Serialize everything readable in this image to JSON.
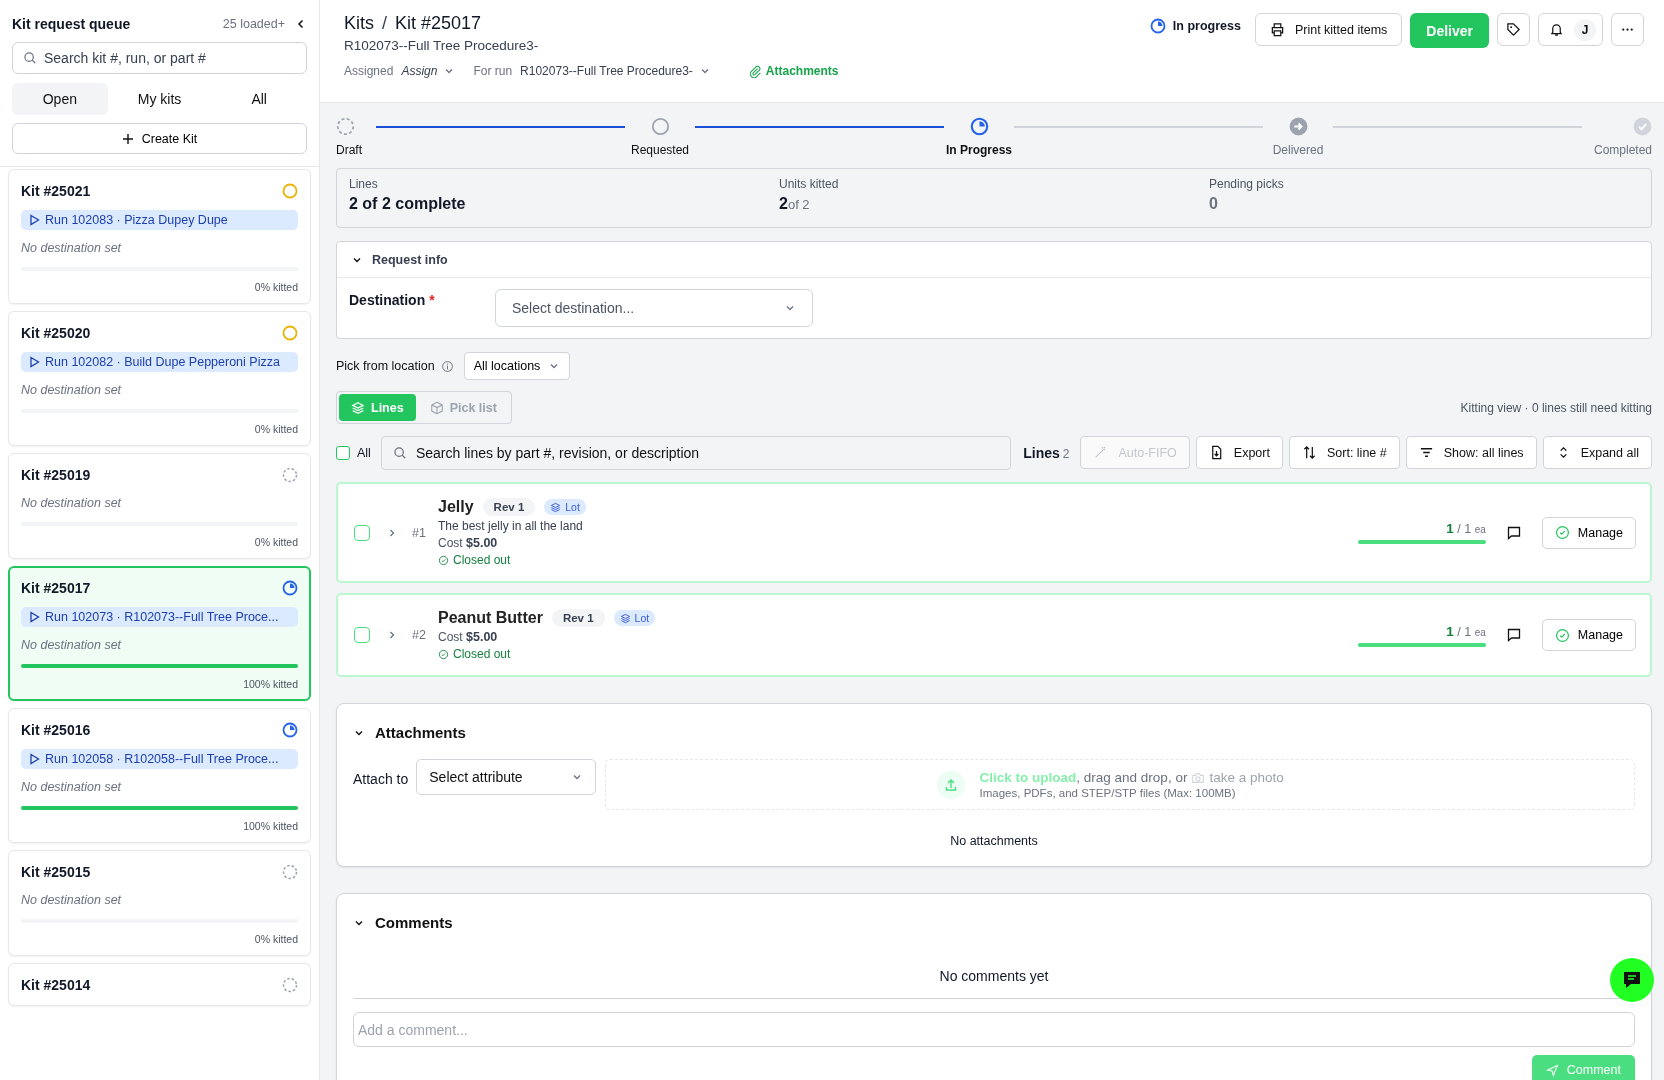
{
  "sidebar": {
    "title": "Kit request queue",
    "count": "25 loaded+",
    "search": {
      "placeholder": "Search kit #, run, or part #"
    },
    "tabs": [
      {
        "label": "Open",
        "selected": true
      },
      {
        "label": "My kits",
        "selected": false
      },
      {
        "label": "All",
        "selected": false
      }
    ],
    "create_button": "Create Kit",
    "kits": [
      {
        "title": "Kit #25021",
        "kind": "requested",
        "run": "Run 102083 · Pizza Dupey Dupe",
        "destination": "No destination set",
        "level": 0,
        "kitted": "0% kitted",
        "selected": false
      },
      {
        "title": "Kit #25020",
        "kind": "requested",
        "run": "Run 102082 · Build Dupe Pepperoni Pizza",
        "destination": "No destination set",
        "level": 0,
        "kitted": "0% kitted",
        "selected": false
      },
      {
        "title": "Kit #25019",
        "kind": "draft",
        "destination": "No destination set",
        "level": 0,
        "kitted": "0% kitted",
        "selected": false
      },
      {
        "title": "Kit #25017",
        "kind": "in_progress",
        "run": "Run 102073 · R102073--Full Tree Proce...",
        "destination": "No destination set",
        "level": 1,
        "kitted": "100% kitted",
        "selected": true
      },
      {
        "title": "Kit #25016",
        "kind": "in_progress",
        "run": "Run 102058 · R102058--Full Tree Proce...",
        "destination": "No destination set",
        "level": 1,
        "kitted": "100% kitted",
        "selected": false
      },
      {
        "title": "Kit #25015",
        "kind": "draft",
        "destination": "No destination set",
        "level": 0,
        "kitted": "0% kitted",
        "selected": false
      },
      {
        "title": "Kit #25014",
        "kind": "draft",
        "selected": false
      }
    ]
  },
  "header": {
    "breadcrumb": [
      "Kits",
      "Kit #25017"
    ],
    "breadcrumb_separator": "/",
    "subtitle": "R102073--Full Tree Procedure3-",
    "status": "In progress",
    "print_button": "Print kitted items",
    "deliver_button": "Deliver",
    "avatar": "J",
    "assigned_label": "Assigned",
    "assigned_value": "Assign",
    "run_label": "For run",
    "run_value": "R102073--Full Tree Procedure3-",
    "attachments_link": "Attachments"
  },
  "stepper": [
    {
      "label": "Draft",
      "completed": true,
      "selected": false
    },
    {
      "label": "Requested",
      "completed": true,
      "selected": false
    },
    {
      "label": "In Progress",
      "completed": false,
      "selected": true
    },
    {
      "label": "Delivered",
      "completed": false,
      "selected": false
    },
    {
      "label": "Completed",
      "completed": false,
      "selected": false
    }
  ],
  "stats": [
    {
      "label": "Lines",
      "value": "2 of 2 complete",
      "muted": false
    },
    {
      "label": "Units kitted",
      "value": "2",
      "suffix": "of 2",
      "muted": false
    },
    {
      "label": "Pending picks",
      "value": "0",
      "muted": true
    }
  ],
  "request_info": {
    "title": "Request info",
    "expanded": true,
    "destination_label": "Destination",
    "required": "*",
    "destination_placeholder": "Select destination..."
  },
  "pick_from": {
    "label": "Pick from location",
    "value": "All locations"
  },
  "view_tabs": [
    {
      "label": "Lines",
      "selected": true
    },
    {
      "label": "Pick list",
      "selected": false
    }
  ],
  "kitting_note": "Kitting view · 0 lines still need kitting",
  "toolbar": {
    "all_label": "All",
    "all_checked": false,
    "search_placeholder": "Search lines by part #, revision, or description",
    "lines_label": "Lines",
    "lines_count": "2",
    "buttons": [
      {
        "label": "Auto-FIFO",
        "disabled": true
      },
      {
        "label": "Export",
        "disabled": false
      },
      {
        "label": "Sort: line #",
        "disabled": false
      },
      {
        "label": "Show: all lines",
        "disabled": false
      },
      {
        "label": "Expand all",
        "disabled": false
      }
    ]
  },
  "lines": [
    {
      "number": "#1",
      "name": "Jelly",
      "rev": "Rev 1",
      "tag": "Lot",
      "description": "The best jelly in all the land",
      "cost_label": "Cost",
      "cost": "$5.00",
      "status": "Closed out",
      "qty": "1",
      "total": "/ 1",
      "unit": "ea",
      "level": 1,
      "checked": false,
      "manage": "Manage"
    },
    {
      "number": "#2",
      "name": "Peanut Butter",
      "rev": "Rev 1",
      "tag": "Lot",
      "cost_label": "Cost",
      "cost": "$5.00",
      "status": "Closed out",
      "qty": "1",
      "total": "/ 1",
      "unit": "ea",
      "level": 1,
      "checked": false,
      "manage": "Manage"
    }
  ],
  "attachments": {
    "title": "Attachments",
    "expanded": true,
    "attach_label": "Attach to",
    "attach_placeholder": "Select attribute",
    "upload_link": "Click to upload",
    "upload_middle": ", drag and drop, or",
    "photo_link": "take a photo",
    "upload_hint": "Images, PDFs, and STEP/STP files (Max: 100MB)",
    "empty": "No attachments"
  },
  "comments": {
    "title": "Comments",
    "expanded": true,
    "empty": "No comments yet",
    "placeholder": "Add a comment...",
    "button": "Comment"
  }
}
